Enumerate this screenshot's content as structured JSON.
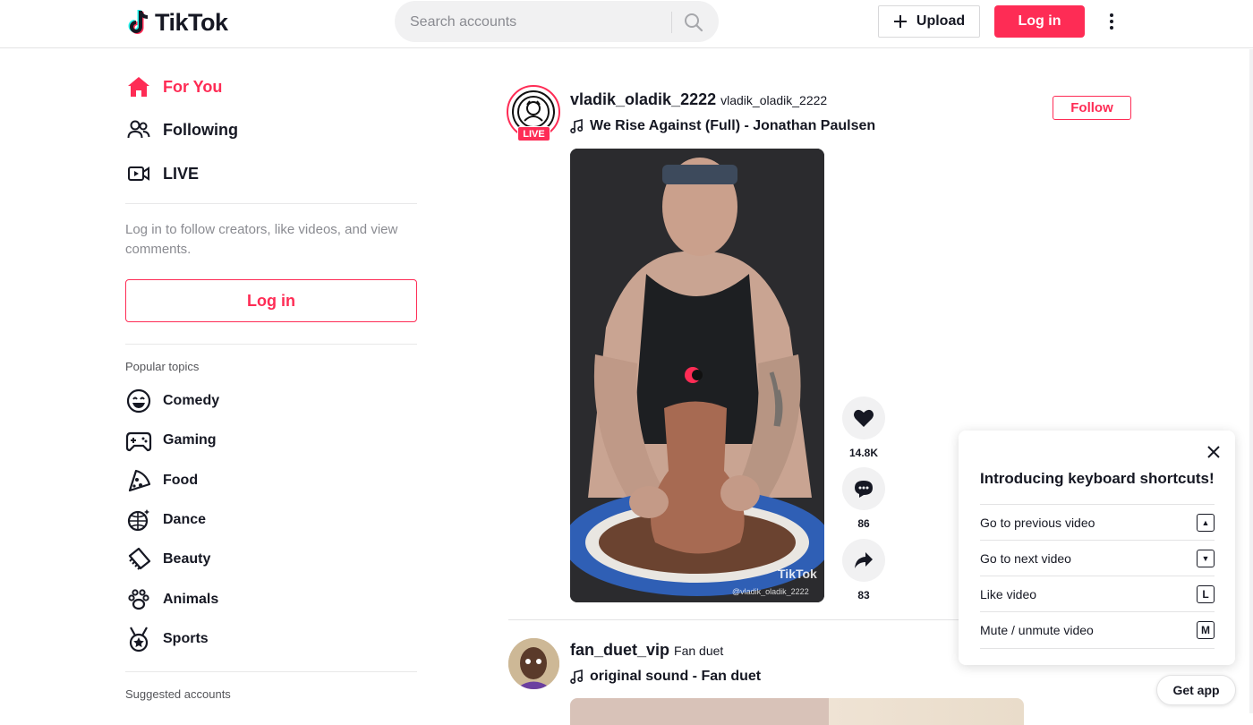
{
  "header": {
    "logo_text": "TikTok",
    "search_placeholder": "Search accounts",
    "upload_label": "Upload",
    "login_label": "Log in"
  },
  "sidebar": {
    "nav": [
      {
        "label": "For You",
        "icon": "home-icon",
        "active": true
      },
      {
        "label": "Following",
        "icon": "people-icon"
      },
      {
        "label": "LIVE",
        "icon": "live-camera-icon"
      }
    ],
    "login_prompt": "Log in to follow creators, like videos, and view comments.",
    "login_button": "Log in",
    "popular_topics_title": "Popular topics",
    "topics": [
      {
        "label": "Comedy",
        "icon": "smile-icon"
      },
      {
        "label": "Gaming",
        "icon": "gamepad-icon"
      },
      {
        "label": "Food",
        "icon": "pizza-icon"
      },
      {
        "label": "Dance",
        "icon": "disco-ball-icon"
      },
      {
        "label": "Beauty",
        "icon": "comb-icon"
      },
      {
        "label": "Animals",
        "icon": "paw-icon"
      },
      {
        "label": "Sports",
        "icon": "medal-icon"
      }
    ],
    "suggested_title": "Suggested accounts"
  },
  "feed": {
    "posts": [
      {
        "username": "vladik_oladik_2222",
        "nickname": "vladik_oladik_2222",
        "live_badge": "LIVE",
        "music": "We Rise Against (Full) - Jonathan Paulsen",
        "follow_label": "Follow",
        "watermark_logo": "TikTok",
        "watermark_user": "@vladik_oladik_2222",
        "likes": "14.8K",
        "comments": "86",
        "shares": "83"
      },
      {
        "username": "fan_duet_vip",
        "nickname": "Fan duet",
        "music": "original sound - Fan duet"
      }
    ]
  },
  "shortcuts_popup": {
    "title": "Introducing keyboard shortcuts!",
    "items": [
      {
        "label": "Go to previous video",
        "key": "▲"
      },
      {
        "label": "Go to next video",
        "key": "▼"
      },
      {
        "label": "Like video",
        "key": "L"
      },
      {
        "label": "Mute / unmute video",
        "key": "M"
      }
    ]
  },
  "get_app_label": "Get app",
  "colors": {
    "accent": "#fe2c55",
    "text": "#161823",
    "muted": "#8a8b91"
  }
}
